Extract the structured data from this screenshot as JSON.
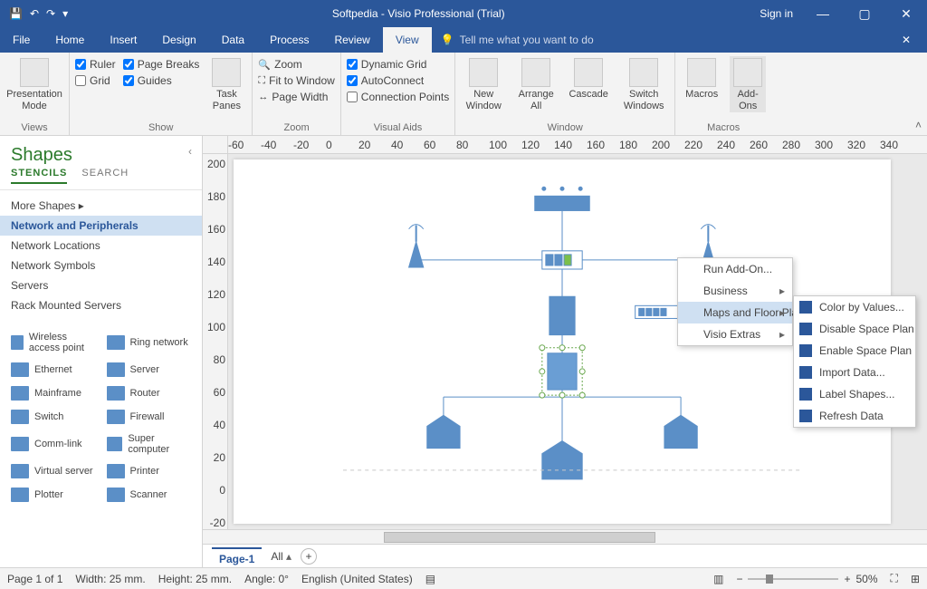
{
  "titlebar": {
    "title": "Softpedia - Visio Professional (Trial)",
    "signin": "Sign in"
  },
  "tabs": [
    "File",
    "Home",
    "Insert",
    "Design",
    "Data",
    "Process",
    "Review",
    "View"
  ],
  "active_tab": "View",
  "tell_me": "Tell me what you want to do",
  "ribbon": {
    "views": {
      "label": "Views",
      "presentation": "Presentation\nMode"
    },
    "show": {
      "label": "Show",
      "ruler": "Ruler",
      "page_breaks": "Page Breaks",
      "grid": "Grid",
      "guides": "Guides",
      "task_panes": "Task\nPanes"
    },
    "zoom": {
      "label": "Zoom",
      "zoom": "Zoom",
      "fit": "Fit to Window",
      "width": "Page Width"
    },
    "visual": {
      "label": "Visual Aids",
      "dynamic": "Dynamic Grid",
      "auto": "AutoConnect",
      "conn": "Connection Points"
    },
    "window": {
      "label": "Window",
      "new": "New\nWindow",
      "arrange": "Arrange\nAll",
      "cascade": "Cascade",
      "switch": "Switch\nWindows"
    },
    "macros": {
      "label": "Macros",
      "macros": "Macros",
      "addons": "Add-\nOns"
    }
  },
  "shapes": {
    "title": "Shapes",
    "tabs": {
      "stencils": "STENCILS",
      "search": "SEARCH"
    },
    "more": "More Shapes",
    "stencil_list": [
      "Network and Peripherals",
      "Network Locations",
      "Network Symbols",
      "Servers",
      "Rack Mounted Servers"
    ],
    "items": [
      {
        "n": "Wireless access point"
      },
      {
        "n": "Ring network"
      },
      {
        "n": "Ethernet"
      },
      {
        "n": "Server"
      },
      {
        "n": "Mainframe"
      },
      {
        "n": "Router"
      },
      {
        "n": "Switch"
      },
      {
        "n": "Firewall"
      },
      {
        "n": "Comm-link"
      },
      {
        "n": "Super computer"
      },
      {
        "n": "Virtual server"
      },
      {
        "n": "Printer"
      },
      {
        "n": "Plotter"
      },
      {
        "n": "Scanner"
      }
    ]
  },
  "ruler_h": [
    "-60",
    "-40",
    "-20",
    "0",
    "20",
    "40",
    "60",
    "80",
    "100",
    "120",
    "140",
    "160",
    "180",
    "200",
    "220",
    "240",
    "260",
    "280",
    "300",
    "320",
    "340"
  ],
  "ruler_v": [
    "200",
    "180",
    "160",
    "140",
    "120",
    "100",
    "80",
    "60",
    "40",
    "20",
    "0",
    "-20"
  ],
  "pagetabs": {
    "page": "Page-1",
    "all": "All"
  },
  "status": {
    "page": "Page 1 of 1",
    "width": "Width: 25 mm.",
    "height": "Height: 25 mm.",
    "angle": "Angle: 0°",
    "lang": "English (United States)",
    "zoom": "50%"
  },
  "menu1": [
    "Run Add-On...",
    "Business",
    "Maps and Floor Plans",
    "Visio Extras"
  ],
  "menu2": [
    "Color by Values...",
    "Disable Space Plan",
    "Enable Space Plan",
    "Import Data...",
    "Label Shapes...",
    "Refresh Data"
  ]
}
